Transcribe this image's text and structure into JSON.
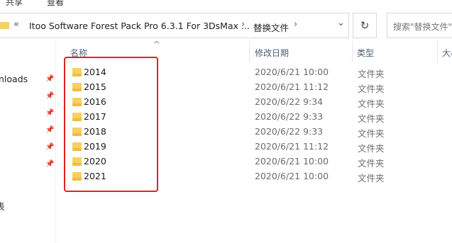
{
  "ribbon": {
    "tabs": [
      "共享",
      "查看"
    ]
  },
  "address": {
    "back_chevron": "«",
    "crumbs": [
      "Itoo Software Forest Pack Pro 6.3.1 For 3DsMax ...",
      "替换文件"
    ],
    "separator": "›",
    "dropdown": "⌄",
    "refresh": "↻"
  },
  "search": {
    "placeholder": "搜索\"替换文件\""
  },
  "nav": {
    "items": [
      {
        "label": "nloads",
        "pinned": true
      },
      {
        "label": "",
        "pinned": true
      },
      {
        "label": "",
        "pinned": true
      },
      {
        "label": "",
        "pinned": true
      },
      {
        "label": "",
        "pinned": true
      },
      {
        "label": "",
        "pinned": true
      }
    ],
    "bottom_label": "表"
  },
  "columns": {
    "name": "名称",
    "date": "修改日期",
    "type": "类型",
    "size": "大小",
    "sort_indicator": "^"
  },
  "rows": [
    {
      "name": "2014",
      "date": "2020/6/21 10:00",
      "type": "文件夹"
    },
    {
      "name": "2015",
      "date": "2020/6/21 11:12",
      "type": "文件夹"
    },
    {
      "name": "2016",
      "date": "2020/6/22 9:34",
      "type": "文件夹"
    },
    {
      "name": "2017",
      "date": "2020/6/22 9:33",
      "type": "文件夹"
    },
    {
      "name": "2018",
      "date": "2020/6/22 9:33",
      "type": "文件夹"
    },
    {
      "name": "2019",
      "date": "2020/6/21 11:12",
      "type": "文件夹"
    },
    {
      "name": "2020",
      "date": "2020/6/21 10:00",
      "type": "文件夹"
    },
    {
      "name": "2021",
      "date": "2020/6/21 10:00",
      "type": "文件夹"
    }
  ],
  "colors": {
    "highlight": "#e0231e",
    "folder": "#f7cf63",
    "header_text": "#4c607a"
  }
}
